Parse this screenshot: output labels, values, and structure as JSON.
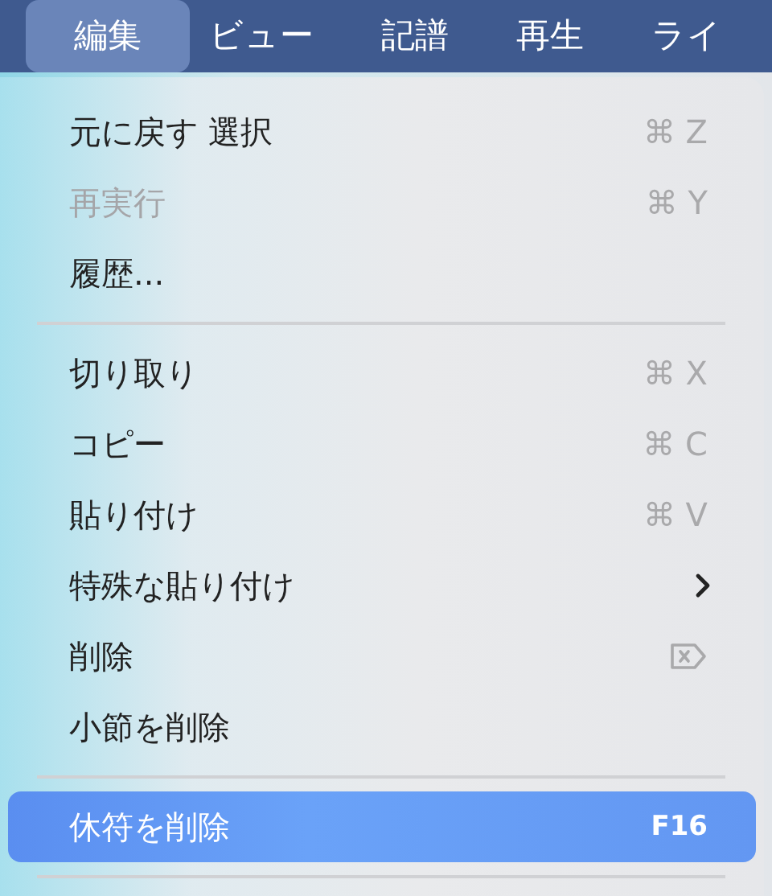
{
  "menubar": [
    {
      "label": "編集",
      "selected": true
    },
    {
      "label": "ビュー",
      "selected": false
    },
    {
      "label": "記譜",
      "selected": false
    },
    {
      "label": "再生",
      "selected": false
    },
    {
      "label": "ライ",
      "selected": false
    }
  ],
  "menu": {
    "items": [
      {
        "kind": "item",
        "label": "元に戻す 選択",
        "shortcut": "⌘ Z",
        "disabled": false,
        "selected": false
      },
      {
        "kind": "item",
        "label": "再実行",
        "shortcut": "⌘ Y",
        "disabled": true,
        "selected": false
      },
      {
        "kind": "item",
        "label": "履歴...",
        "disabled": false,
        "selected": false
      },
      {
        "kind": "separator"
      },
      {
        "kind": "item",
        "label": "切り取り",
        "shortcut": "⌘ X",
        "disabled": false,
        "selected": false
      },
      {
        "kind": "item",
        "label": "コピー",
        "shortcut": "⌘ C",
        "disabled": false,
        "selected": false
      },
      {
        "kind": "item",
        "label": "貼り付け",
        "shortcut": "⌘ V",
        "disabled": false,
        "selected": false
      },
      {
        "kind": "submenu",
        "label": "特殊な貼り付け",
        "disabled": false,
        "selected": false
      },
      {
        "kind": "delete",
        "label": "削除",
        "disabled": false,
        "selected": false
      },
      {
        "kind": "item",
        "label": "小節を削除",
        "disabled": false,
        "selected": false
      },
      {
        "kind": "separator"
      },
      {
        "kind": "item",
        "label": "休符を削除",
        "shortcut": "F16",
        "disabled": false,
        "selected": true
      },
      {
        "kind": "separator"
      }
    ]
  }
}
